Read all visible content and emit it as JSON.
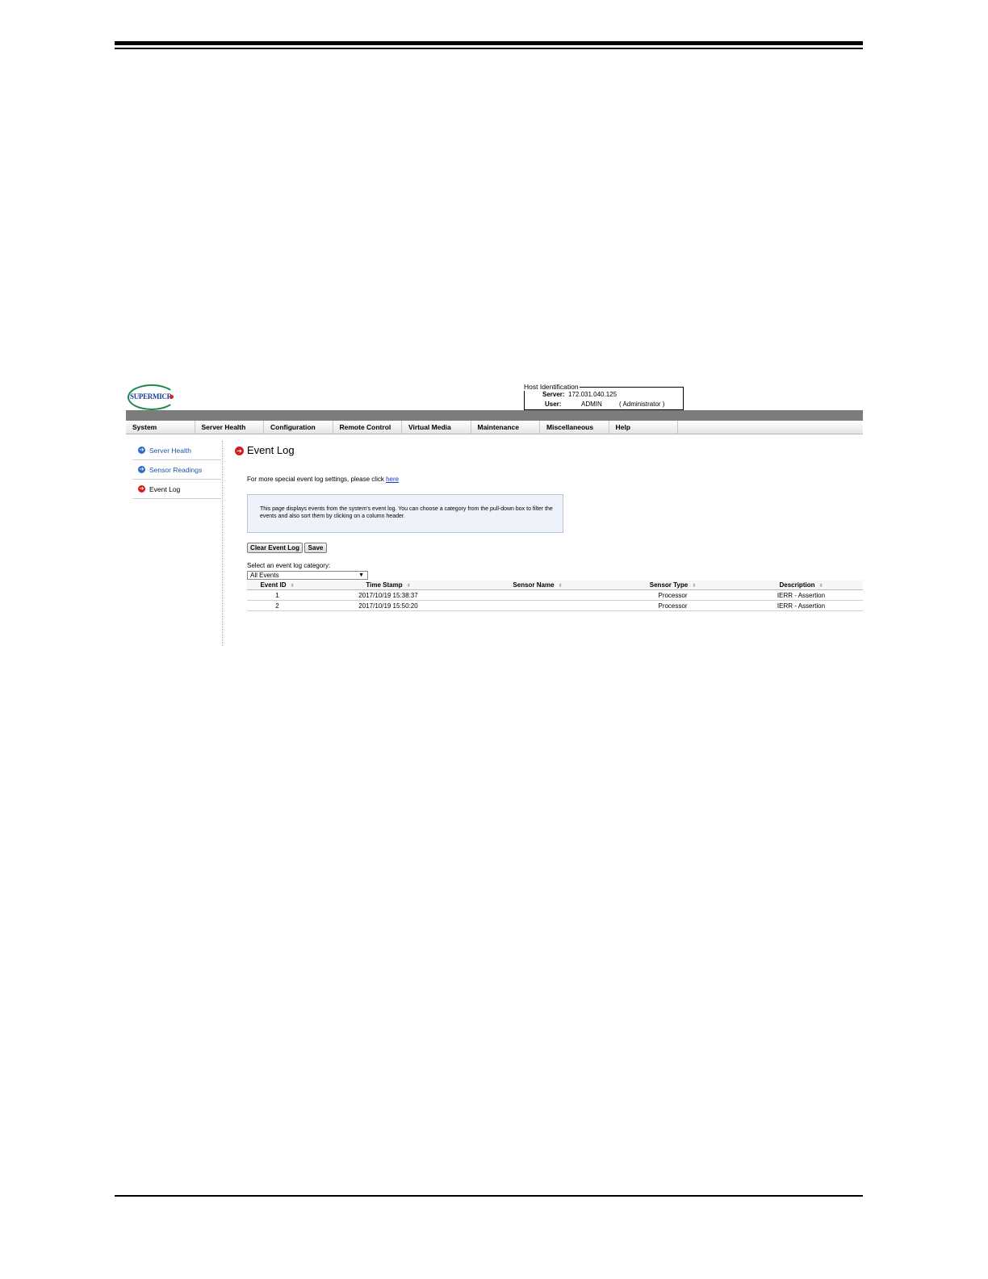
{
  "logo": {
    "text": "SUPERMICR"
  },
  "host": {
    "legend": "Host Identification",
    "server_label": "Server:",
    "server_value": "172.031.040.125",
    "user_label": "User:",
    "user_value": "ADMIN",
    "user_role": "( Administrator )"
  },
  "menu": [
    "System",
    "Server Health",
    "Configuration",
    "Remote Control",
    "Virtual Media",
    "Maintenance",
    "Miscellaneous",
    "Help"
  ],
  "sidebar": {
    "items": [
      {
        "label": "Server Health",
        "icon": "blue-arrow-icon"
      },
      {
        "label": "Sensor Readings",
        "icon": "blue-arrow-icon"
      },
      {
        "label": "Event Log",
        "icon": "red-arrow-icon"
      }
    ]
  },
  "page": {
    "title": "Event Log",
    "hint_text": "For more special event log settings, please click ",
    "hint_link": "here",
    "info": "This page displays events from the system's event log. You can choose a category from the pull-down box to filter the events and also sort them by clicking on a column header.",
    "clear_button": "Clear Event Log",
    "save_button": "Save",
    "select_label": "Select an event log category:",
    "select_value": "All Events"
  },
  "table": {
    "columns": [
      "Event ID",
      "Time Stamp",
      "Sensor Name",
      "Sensor Type",
      "Description"
    ],
    "rows": [
      [
        "1",
        "2017/10/19 15:38:37",
        "",
        "Processor",
        "IERR - Assertion"
      ],
      [
        "2",
        "2017/10/19 15:50:20",
        "",
        "Processor",
        "IERR - Assertion"
      ]
    ]
  },
  "colors": {
    "menu_bar": "#7c7c7c",
    "logo_green": "#1b8a4a",
    "logo_blue": "#1a3f8f",
    "active_red": "#d41c1c",
    "link_blue": "#1c57a8"
  }
}
